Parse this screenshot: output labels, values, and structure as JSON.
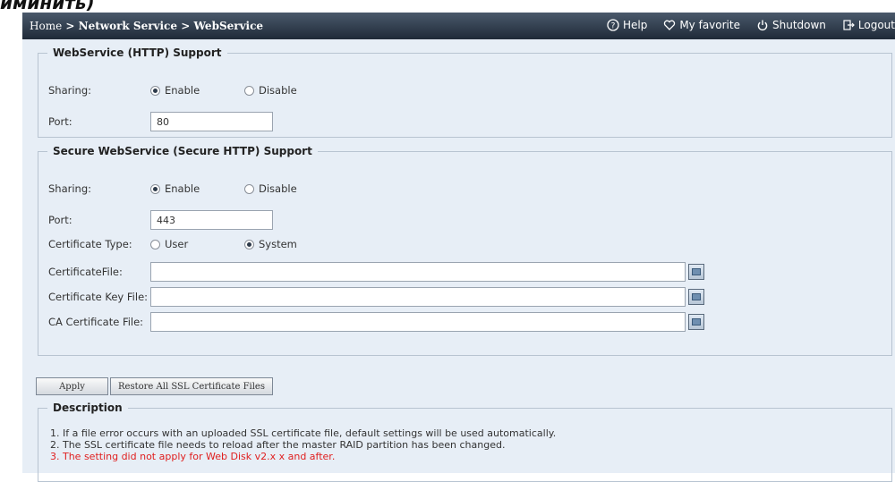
{
  "top_fragment": "иминить)",
  "header": {
    "home": "Home",
    "separator": ">",
    "section": "Network Service",
    "page": "WebService",
    "links": {
      "help": "Help",
      "favorite": "My favorite",
      "shutdown": "Shutdown",
      "logout": "Logout"
    }
  },
  "http": {
    "title": "WebService (HTTP) Support",
    "sharing_label": "Sharing:",
    "enable_label": "Enable",
    "disable_label": "Disable",
    "sharing_value": "Enable",
    "port_label": "Port:",
    "port_value": "80"
  },
  "https": {
    "title": "Secure WebService (Secure HTTP) Support",
    "sharing_label": "Sharing:",
    "enable_label": "Enable",
    "disable_label": "Disable",
    "sharing_value": "Enable",
    "port_label": "Port:",
    "port_value": "443",
    "cert_type_label": "Certificate Type:",
    "cert_user_label": "User",
    "cert_system_label": "System",
    "cert_type_value": "System",
    "cert_file_label": "CertificateFile:",
    "cert_key_label": "Certificate Key File:",
    "ca_cert_label": "CA Certificate File:"
  },
  "buttons": {
    "apply": "Apply",
    "restore": "Restore All SSL Certificate Files"
  },
  "description": {
    "title": "Description",
    "lines": [
      "1. If a file error occurs with an uploaded SSL certificate file, default settings will be used automatically.",
      "2. The SSL certificate file needs to reload after the master RAID partition has been changed.",
      "3. The setting did not apply for Web Disk v2.x x and after."
    ]
  },
  "colors": {
    "header_bg": "#2c3747",
    "panel_bg": "#e7eef6",
    "warning_text": "#e02020"
  }
}
